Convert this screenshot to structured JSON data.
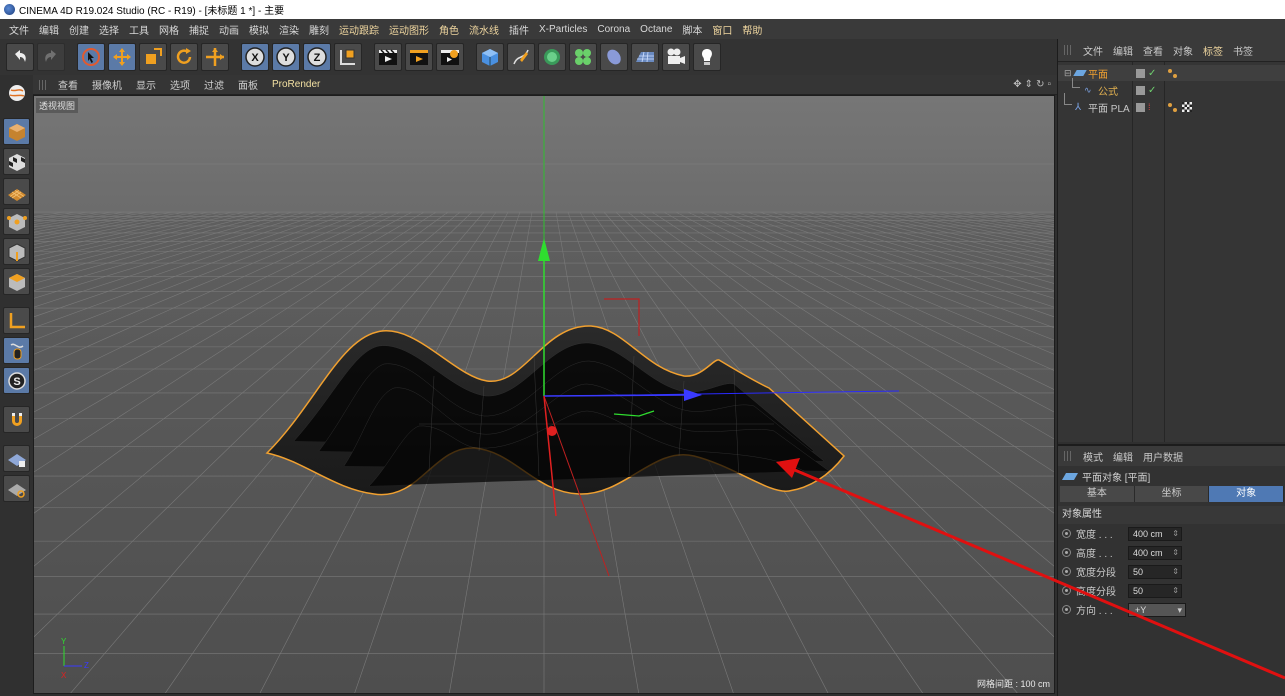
{
  "window": {
    "title": "CINEMA 4D R19.024 Studio (RC - R19) - [未标题 1 *] - 主要"
  },
  "menubar": {
    "items": [
      "文件",
      "编辑",
      "创建",
      "选择",
      "工具",
      "网格",
      "捕捉",
      "动画",
      "模拟",
      "渲染",
      "雕刻",
      "运动跟踪",
      "运动图形",
      "角色",
      "流水线",
      "插件",
      "X-Particles",
      "Corona",
      "Octane",
      "脚本",
      "窗口",
      "帮助"
    ]
  },
  "toolbar": {
    "icons": [
      "undo-icon",
      "redo-icon",
      "live-selection-icon",
      "move-icon",
      "scale-icon",
      "rotate-icon",
      "transform-icon",
      "x-axis-icon",
      "y-axis-icon",
      "z-axis-icon",
      "coordinate-system-icon",
      "render-view-icon",
      "render-picture-viewer-icon",
      "render-settings-icon",
      "cube-icon",
      "pen-icon",
      "subdivision-icon",
      "cloner-icon",
      "deformer-icon",
      "floor-icon",
      "camera-icon",
      "light-icon"
    ]
  },
  "viewport": {
    "menu": [
      "查看",
      "摄像机",
      "显示",
      "选项",
      "过滤",
      "面板",
      "ProRender"
    ],
    "label": "透视视图",
    "grid_spacing": "网格间距 : 100 cm",
    "axis_labels": {
      "y": "Y",
      "z": "Z",
      "x": "X"
    }
  },
  "object_manager": {
    "tabs": [
      "文件",
      "编辑",
      "查看",
      "对象",
      "标签",
      "书签"
    ],
    "objects": [
      {
        "name": "平面",
        "level": 0
      },
      {
        "name": "公式",
        "level": 1
      },
      {
        "name": "平面 PLA",
        "level": 0
      }
    ]
  },
  "attributes": {
    "tabs": [
      "模式",
      "编辑",
      "用户数据"
    ],
    "object_title": "平面对象 [平面]",
    "subtabs": [
      "基本",
      "坐标",
      "对象"
    ],
    "active_subtab": "对象",
    "section": "对象属性",
    "fields": [
      {
        "label": "宽度 . . .",
        "value": "400 cm"
      },
      {
        "label": "高度 . . .",
        "value": "400 cm"
      },
      {
        "label": "宽度分段",
        "value": "50"
      },
      {
        "label": "高度分段",
        "value": "50"
      }
    ],
    "orientation": {
      "label": "方向 . . .",
      "value": "+Y"
    }
  },
  "colors": {
    "accent": "#4f79b4",
    "selection_outline": "#f0a030",
    "annotation": "#e01010"
  }
}
